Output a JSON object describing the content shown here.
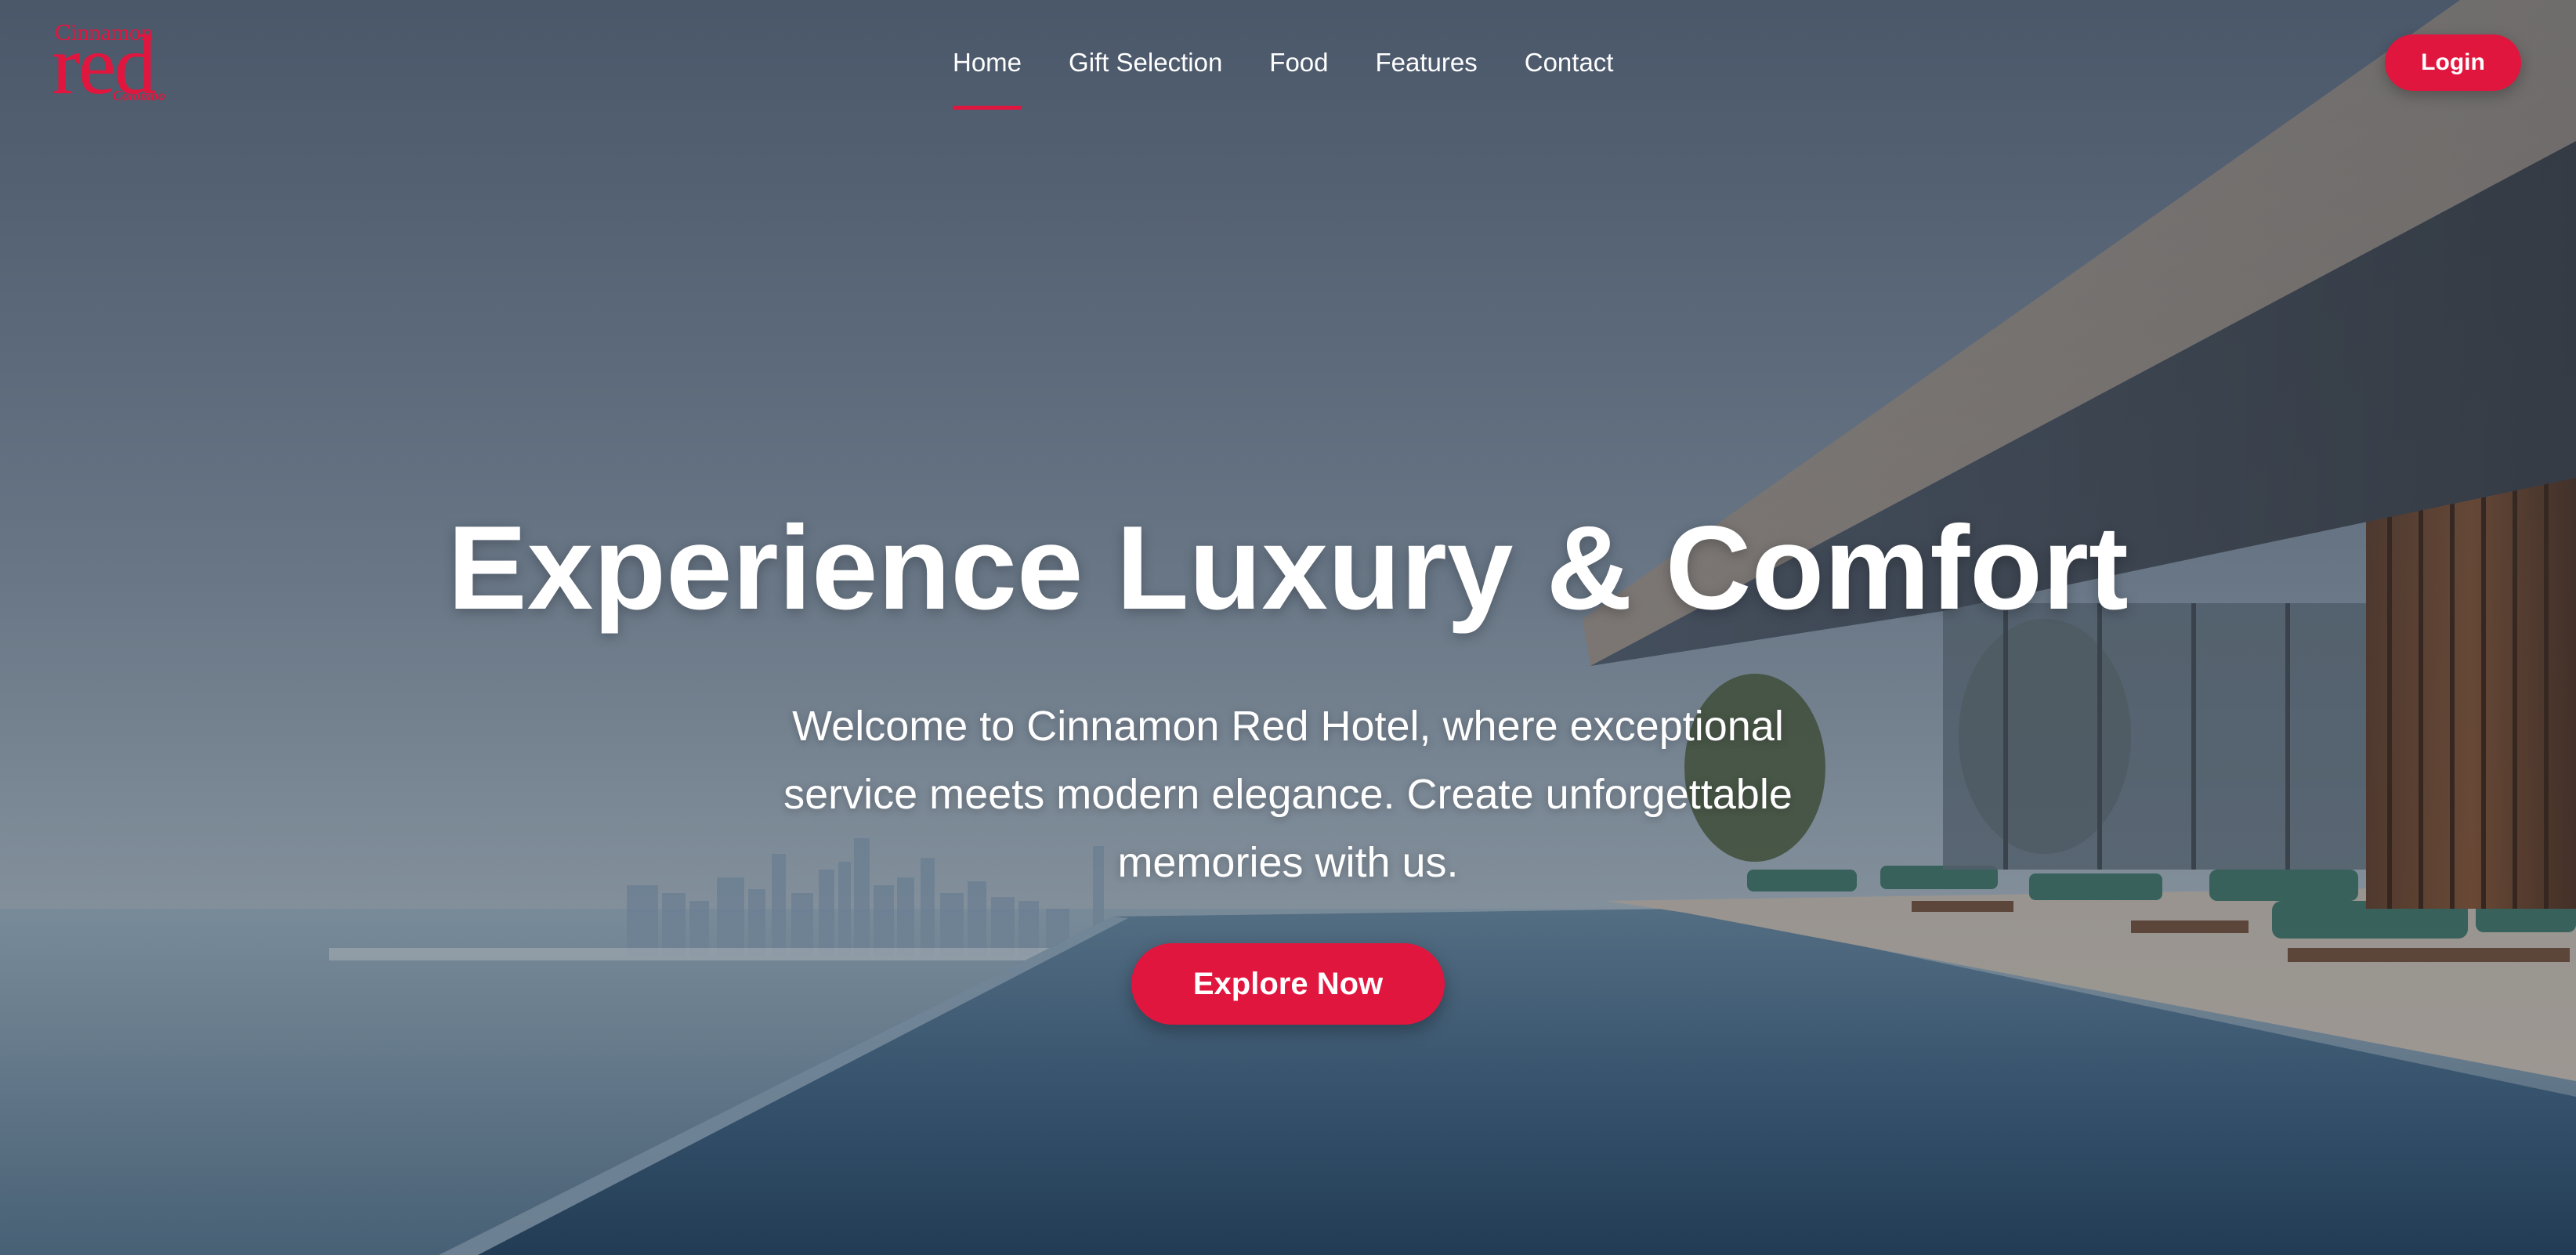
{
  "brand": {
    "logo_top": "Cinnamon",
    "logo_main": "red",
    "logo_sub": "Colombo",
    "accent_color": "#e0163e"
  },
  "nav": {
    "items": [
      {
        "label": "Home",
        "active": true
      },
      {
        "label": "Gift Selection",
        "active": false
      },
      {
        "label": "Food",
        "active": false
      },
      {
        "label": "Features",
        "active": false
      },
      {
        "label": "Contact",
        "active": false
      }
    ]
  },
  "header": {
    "login_label": "Login"
  },
  "hero": {
    "title": "Experience Luxury & Comfort",
    "subtitle": "Welcome to Cinnamon Red Hotel, where exceptional service meets modern elegance. Create unforgettable memories with us.",
    "cta_label": "Explore Now",
    "background": "infinity-pool-city-skyline-image"
  }
}
